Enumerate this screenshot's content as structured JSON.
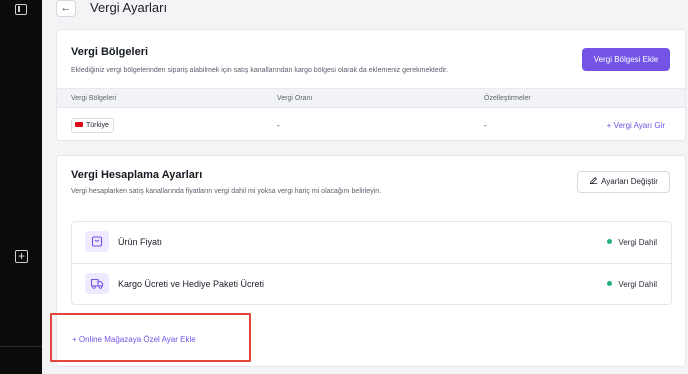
{
  "page": {
    "title": "Vergi Ayarları",
    "back_icon": "arrow-left-icon"
  },
  "sidebar": {
    "top_icon": "sidebar-panel-icon",
    "bottom_icon": "plus-square-icon",
    "bottom_label": "+"
  },
  "tax_regions": {
    "title": "Vergi Bölgeleri",
    "description": "Eklediğiniz vergi bölgelerinden sipariş alabilmek için satış kanallarından kargo bölgesi olarak da eklemeniz gerekmektedir.",
    "add_button": "Vergi Bölgesi Ekle",
    "columns": [
      "Vergi Bölgeleri",
      "Vergi Oranı",
      "Özelleştirmeler"
    ],
    "rows": [
      {
        "region": "Türkiye",
        "flag": "tr-flag-icon",
        "rate": "-",
        "custom": "-",
        "action": "+ Vergi Ayarı Gir"
      }
    ]
  },
  "tax_calc": {
    "title": "Vergi Hesaplama Ayarları",
    "description": "Vergi hesaplarken satış kanallarında fiyatların vergi dahil mi yoksa vergi hariç mi olacağını belirleyin.",
    "edit_button": "Ayarları Değiştir",
    "edit_icon": "pencil-icon",
    "items": [
      {
        "label": "Ürün Fiyatı",
        "icon": "shopping-bag-icon",
        "status": "Vergi Dahil"
      },
      {
        "label": "Kargo Ücreti ve Hediye Paketi Ücreti",
        "icon": "truck-icon",
        "status": "Vergi Dahil"
      }
    ],
    "add_store_link": "+ Online Mağazaya Özel Ayar Ekle"
  },
  "colors": {
    "accent": "#7453e7",
    "status_green": "#22b07d",
    "highlight_red": "#e2463b",
    "sidebar": "#0b0b0c"
  }
}
